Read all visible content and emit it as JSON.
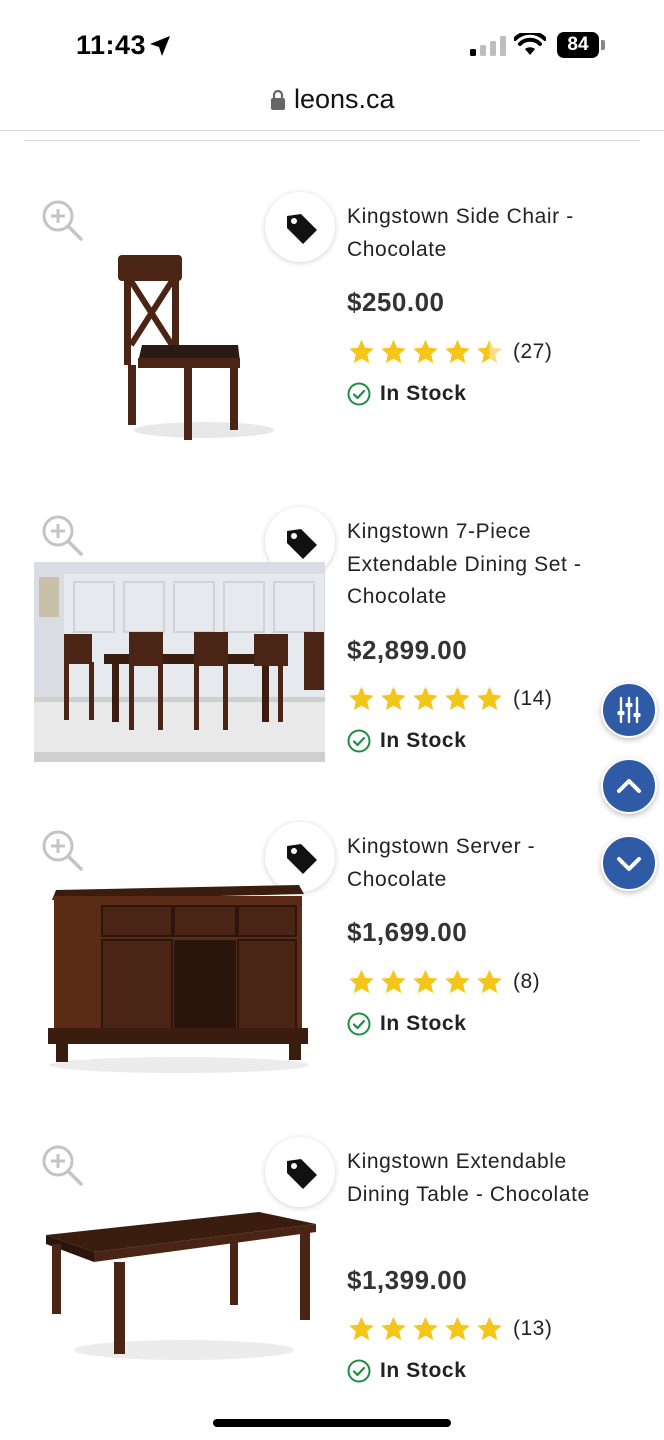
{
  "status_bar": {
    "time": "11:43",
    "battery": "84"
  },
  "browser": {
    "url": "leons.ca"
  },
  "products": [
    {
      "name": "Kingstown Side Chair - Chocolate",
      "price": "$250.00",
      "rating": 4.5,
      "review_count": "(27)",
      "stock": "In Stock"
    },
    {
      "name": "Kingstown 7-Piece Extendable Dining Set - Chocolate",
      "price": "$2,899.00",
      "rating": 5,
      "review_count": "(14)",
      "stock": "In Stock"
    },
    {
      "name": "Kingstown Server - Chocolate",
      "price": "$1,699.00",
      "rating": 5,
      "review_count": "(8)",
      "stock": "In Stock"
    },
    {
      "name": "Kingstown Extendable Dining Table - Chocolate",
      "price": "$1,399.00",
      "rating": 5,
      "review_count": "(13)",
      "stock": "In Stock"
    }
  ],
  "icons": {
    "zoom": "zoom-in-icon",
    "tag": "price-tag-icon",
    "stock": "check-circle-icon",
    "filter": "sliders-icon",
    "up": "chevron-up-icon",
    "down": "chevron-down-icon"
  },
  "colors": {
    "star": "#f5c518",
    "stock_green": "#1e8e3e",
    "fab_blue": "#2f5aa5",
    "wood": "#4a2414"
  }
}
